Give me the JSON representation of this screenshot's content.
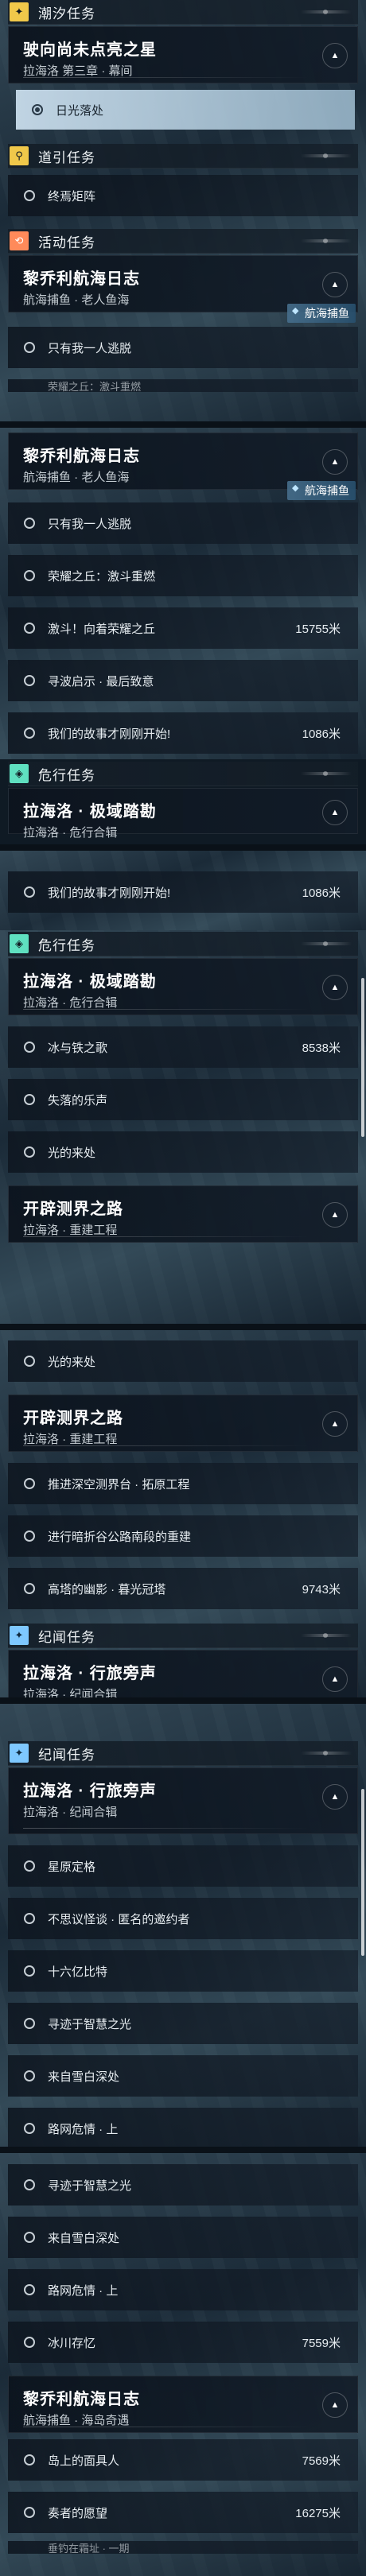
{
  "categories": {
    "chaoxi": "潮汐任务",
    "daoyin": "道引任务",
    "huodong": "活动任务",
    "weixing": "危行任务",
    "jiwen": "纪闻任务"
  },
  "quests": {
    "jiaxiang": {
      "title": "驶向尚未点亮之星",
      "sub": "拉海洛 第三章 · 幕间"
    },
    "liqiaoli": {
      "title": "黎乔利航海日志",
      "sub": "航海捕鱼 · 老人鱼海"
    },
    "lahailuo_jiyu": {
      "title": "拉海洛 · 极域踏勘",
      "sub": "拉海洛 · 危行合辑"
    },
    "kaipi": {
      "title": "开辟测界之路",
      "sub": "拉海洛 · 重建工程"
    },
    "lvlv": {
      "title": "拉海洛 · 行旅旁声",
      "sub": "拉海洛 · 纪闻合辑"
    },
    "liqiaoli2": {
      "title": "黎乔利航海日志",
      "sub": "航海捕鱼 · 海岛奇遇"
    }
  },
  "tag": "航海捕鱼",
  "tasks": {
    "riguang": "日光落处",
    "zhongyan": "终焉矩阵",
    "zhiyou": "只有我一人逃脱",
    "rongyao": "荣耀之丘：激斗重燃",
    "jidou": "激斗！向着荣耀之丘",
    "xunbo": "寻波启示 · 最后致意",
    "gushi": "我们的故事才刚刚开始!",
    "bing": "冰与铁之歌",
    "shizong": "失落的乐声",
    "guang": "光的来处",
    "tuijin": "推进深空测界台 · 拓原工程",
    "jinxing": "进行暗折谷公路南段的重建",
    "gaota": "高塔的幽影 · 暮光冠塔",
    "xingyuan": "星原定格",
    "buxiang": "不思议怪谈 · 匿名的邀约者",
    "shiliu": "十六亿比特",
    "xunji": "寻迹于智慧之光",
    "laizi": "来自雪白深处",
    "lujing": "路网危情 · 上",
    "binghe": "冰川存忆",
    "daoshang": "岛上的面具人",
    "zouzhe": "奏者的愿望",
    "zhiyu": "垂钓在霜址 · 一期"
  },
  "dist": {
    "jidou": "15755米",
    "gushi": "1086米",
    "bing": "8538米",
    "gaota": "9743米",
    "binghe": "7559米",
    "daoshang": "7569米",
    "zouzhe": "16275米"
  },
  "icons": {
    "chaoxi": "sparkle-icon",
    "daoyin": "location-pin-icon",
    "huodong": "activity-icon",
    "weixing": "crystal-icon",
    "jiwen": "sparkle-icon"
  },
  "colors": {
    "yellow": "#f0c84a",
    "orange": "#ff8a5a",
    "teal": "#5fe0c0",
    "blue": "#7ec8ff"
  }
}
